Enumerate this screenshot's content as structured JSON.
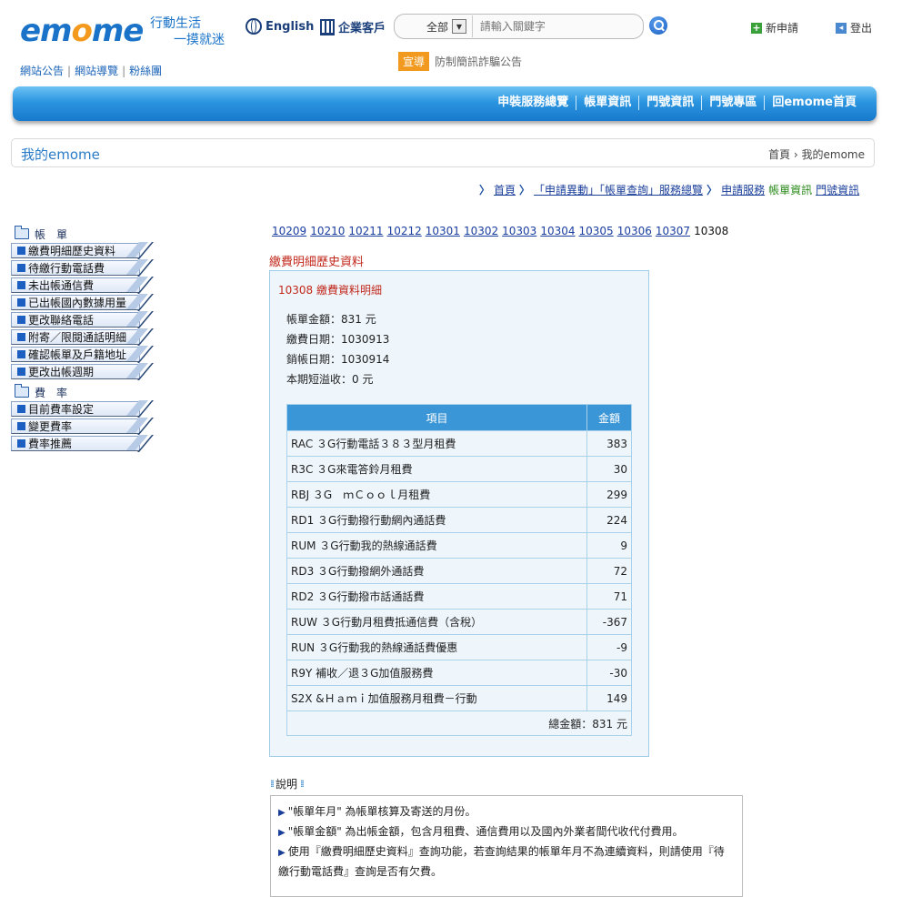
{
  "header": {
    "logo_text_pre": "em",
    "logo_text_o": "o",
    "logo_text_post": "me",
    "slogan_line1": "行動生活",
    "slogan_line2": "一摸就迷",
    "english": "English",
    "enterprise": "企業客戶",
    "search_scope": "全部",
    "search_placeholder": "請輸入關鍵字",
    "new_apply": "新申請",
    "logout": "登出",
    "links": [
      "網站公告",
      "網站導覽",
      "粉絲團"
    ],
    "news_badge": "宣導",
    "news_text": "防制簡訊詐騙公告"
  },
  "nav": {
    "items": [
      "申裝服務總覽",
      "帳單資訊",
      "門號資訊",
      "門號專區",
      "回emome首頁"
    ]
  },
  "my": {
    "title": "我的emome",
    "crumb": "首頁 › 我的emome"
  },
  "trail": {
    "home": "首頁",
    "change": "「申請異動」「帳單查詢」服務總覽",
    "service": "申請服務",
    "bill_info": "帳單資訊",
    "number_info": "門號資訊"
  },
  "sidebar": {
    "section1": "帳　單",
    "items1": [
      "繳費明細歷史資料",
      "待繳行動電話費",
      "未出帳通信費",
      "已出帳國內數據用量",
      "更改聯絡電話",
      "附寄／限閱通話明細",
      "確認帳單及戶籍地址",
      "更改出帳週期"
    ],
    "section2": "費　率",
    "items2": [
      "目前費率設定",
      "變更費率",
      "費率推薦"
    ]
  },
  "periods": {
    "links": [
      "10209",
      "10210",
      "10211",
      "10212",
      "10301",
      "10302",
      "10303",
      "10304",
      "10305",
      "10306",
      "10307"
    ],
    "current": "10308"
  },
  "detail": {
    "section_title": "繳費明細歷史資料",
    "panel_title": "10308 繳費資料明細",
    "bill_amount": "帳單金額：831 元",
    "pay_date": "繳費日期：1030913",
    "close_date": "銷帳日期：1030914",
    "overpay": "本期短溢收：0 元",
    "col_item": "項目",
    "col_amount": "金額",
    "rows": [
      {
        "item": "RAC ３G行動電話３８３型月租費",
        "amount": "383"
      },
      {
        "item": "R3C ３G來電答鈴月租費",
        "amount": "30"
      },
      {
        "item": "RBJ ３G　ｍＣｏｏｌ月租費",
        "amount": "299"
      },
      {
        "item": "RD1 ３G行動撥行動網內通話費",
        "amount": "224"
      },
      {
        "item": "RUM ３G行動我的熱線通話費",
        "amount": "9"
      },
      {
        "item": "RD3 ３G行動撥網外通話費",
        "amount": "72"
      },
      {
        "item": "RD2 ３G行動撥市話通話費",
        "amount": "71"
      },
      {
        "item": "RUW ３G行動月租費抵通信費（含稅）",
        "amount": "-367"
      },
      {
        "item": "RUN ３G行動我的熱線通話費優惠",
        "amount": "-9"
      },
      {
        "item": "R9Y 補收／退３G加值服務費",
        "amount": "-30"
      },
      {
        "item": "S2X &Ｈａｍｉ加值服務月租費－行動",
        "amount": "149"
      }
    ],
    "total": "總金額：831 元"
  },
  "notes": {
    "title": "說明",
    "items": [
      "\"帳單年月\" 為帳單核算及寄送的月份。",
      "\"帳單金額\" 為出帳金額，包含月租費、通信費用以及國內外業者間代收代付費用。",
      "使用『繳費明細歷史資料』查詢功能，若查詢結果的帳單年月不為連續資料，則請使用『待繳行動電話費』查詢是否有欠費。"
    ]
  }
}
